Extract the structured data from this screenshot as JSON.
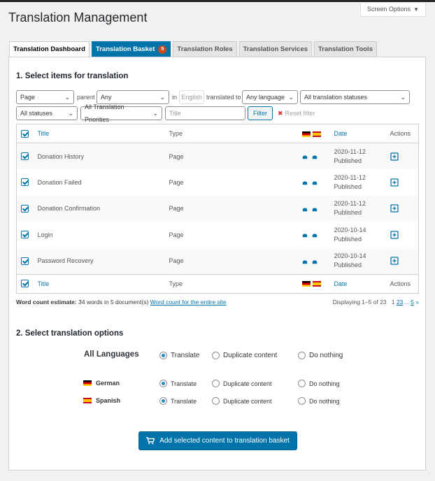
{
  "screen_options": {
    "label": "Screen Options"
  },
  "page_title": "Translation Management",
  "tabs": [
    {
      "label": "Translation Dashboard"
    },
    {
      "label": "Translation Basket",
      "badge": "5"
    },
    {
      "label": "Translation Roles"
    },
    {
      "label": "Translation Services"
    },
    {
      "label": "Translation Tools"
    }
  ],
  "section1": {
    "title": "1. Select items for translation"
  },
  "filters": {
    "post_type": "Page",
    "parent_label": "parent",
    "parent_value": "Any",
    "in_label": "in",
    "language_placeholder": "English",
    "translated_to_label": "translated to",
    "translated_to_value": "Any language",
    "translation_status": "All translation statuses",
    "status": "All statuses",
    "priority": "All Translation Priorities",
    "title_placeholder": "Title",
    "filter_button": "Filter",
    "reset_filter": "Reset filter"
  },
  "table": {
    "headers": {
      "title": "Title",
      "type": "Type",
      "date": "Date",
      "actions": "Actions"
    },
    "rows": [
      {
        "title": "Donation History",
        "type": "Page",
        "date": "2020-11-12",
        "status": "Published"
      },
      {
        "title": "Donation Failed",
        "type": "Page",
        "date": "2020-11-12",
        "status": "Published"
      },
      {
        "title": "Donation Confirmation",
        "type": "Page",
        "date": "2020-11-12",
        "status": "Published"
      },
      {
        "title": "Login",
        "type": "Page",
        "date": "2020-10-14",
        "status": "Published"
      },
      {
        "title": "Password Recovery",
        "type": "Page",
        "date": "2020-10-14",
        "status": "Published"
      }
    ]
  },
  "word_count": {
    "label": "Word count estimate:",
    "value": "34 words in 5 document(s)",
    "link": "Word count for the entire site"
  },
  "pagination": {
    "displaying": "Displaying 1–5 of 23",
    "p1": "1",
    "p2": "2",
    "p3": "3",
    "ellipsis": "…",
    "p5": "5",
    "next": "»"
  },
  "section2": {
    "title": "2. Select translation options"
  },
  "options": {
    "all_languages": "All Languages",
    "translate": "Translate",
    "duplicate": "Duplicate content",
    "nothing": "Do nothing",
    "languages": [
      {
        "name": "German",
        "flag": "flag-de"
      },
      {
        "name": "Spanish",
        "flag": "flag-es"
      }
    ]
  },
  "add_button": {
    "label": "Add selected content to translation basket"
  },
  "colors": {
    "accent": "#0073aa",
    "badge": "#ca4a1f"
  }
}
